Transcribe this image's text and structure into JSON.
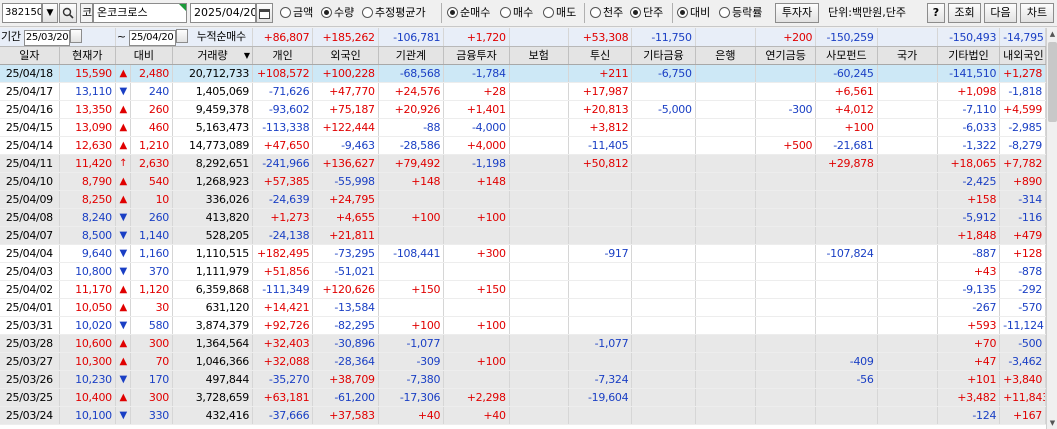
{
  "toolbar": {
    "code": "382150",
    "market_glyph": "코",
    "name": "온코크로스",
    "date": "2025/04/20",
    "radios1": [
      {
        "label": "금액",
        "on": false
      },
      {
        "label": "수량",
        "on": true
      },
      {
        "label": "추정평균가",
        "on": false
      }
    ],
    "radios2": [
      {
        "label": "순매수",
        "on": true
      },
      {
        "label": "매수",
        "on": false
      },
      {
        "label": "매도",
        "on": false
      }
    ],
    "radios3": [
      {
        "label": "천주",
        "on": false
      },
      {
        "label": "단주",
        "on": true
      }
    ],
    "radios4": [
      {
        "label": "대비",
        "on": true
      },
      {
        "label": "등락률",
        "on": false
      }
    ],
    "investor_button": "투자자",
    "unit_text": "단위:백만원,단주",
    "help": "?",
    "query": "조회",
    "next": "다음",
    "chart": "차트"
  },
  "summary": {
    "period_label": "기간",
    "from": "25/03/20",
    "tilde": "~",
    "to": "25/04/20",
    "cum_label": "누적순매수",
    "values": [
      "+86,807",
      "+185,262",
      "-106,781",
      "+1,720",
      "",
      "+53,308",
      "-11,750",
      "",
      "+200",
      "-150,259",
      "",
      "-150,493",
      "-14,795"
    ],
    "colors": [
      "r",
      "r",
      "b",
      "r",
      "k",
      "r",
      "b",
      "k",
      "r",
      "b",
      "k",
      "b",
      "b"
    ]
  },
  "headers": [
    "일자",
    "현재가",
    "대비",
    "거래량",
    "개인",
    "외국인",
    "기관계",
    "금융투자",
    "보험",
    "투신",
    "기타금융",
    "은행",
    "연기금등",
    "사모펀드",
    "국가",
    "기타법인",
    "내외국인"
  ],
  "rows": [
    {
      "cells": [
        "25/04/18",
        "15,590",
        "▲",
        "2,480",
        "20,712,733",
        "+108,572",
        "+100,228",
        "-68,568",
        "-1,784",
        "",
        "+211",
        "-6,750",
        "",
        "",
        "-60,245",
        "",
        "-141,510",
        "+1,278"
      ],
      "sel": true
    },
    {
      "cells": [
        "25/04/17",
        "13,110",
        "▼",
        "240",
        "1,405,069",
        "-71,626",
        "+47,770",
        "+24,576",
        "+28",
        "",
        "+17,987",
        "",
        "",
        "",
        "+6,561",
        "",
        "+1,098",
        "-1,818"
      ]
    },
    {
      "cells": [
        "25/04/16",
        "13,350",
        "▲",
        "260",
        "9,459,378",
        "-93,602",
        "+75,187",
        "+20,926",
        "+1,401",
        "",
        "+20,813",
        "-5,000",
        "",
        "-300",
        "+4,012",
        "",
        "-7,110",
        "+4,599"
      ]
    },
    {
      "cells": [
        "25/04/15",
        "13,090",
        "▲",
        "460",
        "5,163,473",
        "-113,338",
        "+122,444",
        "-88",
        "-4,000",
        "",
        "+3,812",
        "",
        "",
        "",
        "+100",
        "",
        "-6,033",
        "-2,985"
      ]
    },
    {
      "cells": [
        "25/04/14",
        "12,630",
        "▲",
        "1,210",
        "14,773,089",
        "+47,650",
        "-9,463",
        "-28,586",
        "+4,000",
        "",
        "-11,405",
        "",
        "",
        "+500",
        "-21,681",
        "",
        "-1,322",
        "-8,279"
      ]
    },
    {
      "cells": [
        "25/04/11",
        "11,420",
        "↑",
        "2,630",
        "8,292,651",
        "-241,966",
        "+136,627",
        "+79,492",
        "-1,198",
        "",
        "+50,812",
        "",
        "",
        "",
        "+29,878",
        "",
        "+18,065",
        "+7,782"
      ]
    },
    {
      "cells": [
        "25/04/10",
        "8,790",
        "▲",
        "540",
        "1,268,923",
        "+57,385",
        "-55,998",
        "+148",
        "+148",
        "",
        "",
        "",
        "",
        "",
        "",
        "",
        "-2,425",
        "+890"
      ]
    },
    {
      "cells": [
        "25/04/09",
        "8,250",
        "▲",
        "10",
        "336,026",
        "-24,639",
        "+24,795",
        "",
        "",
        "",
        "",
        "",
        "",
        "",
        "",
        "",
        "+158",
        "-314"
      ]
    },
    {
      "cells": [
        "25/04/08",
        "8,240",
        "▼",
        "260",
        "413,820",
        "+1,273",
        "+4,655",
        "+100",
        "+100",
        "",
        "",
        "",
        "",
        "",
        "",
        "",
        "-5,912",
        "-116"
      ]
    },
    {
      "cells": [
        "25/04/07",
        "8,500",
        "▼",
        "1,140",
        "528,205",
        "-24,138",
        "+21,811",
        "",
        "",
        "",
        "",
        "",
        "",
        "",
        "",
        "",
        "+1,848",
        "+479"
      ]
    },
    {
      "cells": [
        "25/04/04",
        "9,640",
        "▼",
        "1,160",
        "1,110,515",
        "+182,495",
        "-73,295",
        "-108,441",
        "+300",
        "",
        "-917",
        "",
        "",
        "",
        "-107,824",
        "",
        "-887",
        "+128"
      ]
    },
    {
      "cells": [
        "25/04/03",
        "10,800",
        "▼",
        "370",
        "1,111,979",
        "+51,856",
        "-51,021",
        "",
        "",
        "",
        "",
        "",
        "",
        "",
        "",
        "",
        "+43",
        "-878"
      ]
    },
    {
      "cells": [
        "25/04/02",
        "11,170",
        "▲",
        "1,120",
        "6,359,868",
        "-111,349",
        "+120,626",
        "+150",
        "+150",
        "",
        "",
        "",
        "",
        "",
        "",
        "",
        "-9,135",
        "-292"
      ]
    },
    {
      "cells": [
        "25/04/01",
        "10,050",
        "▲",
        "30",
        "631,120",
        "+14,421",
        "-13,584",
        "",
        "",
        "",
        "",
        "",
        "",
        "",
        "",
        "",
        "-267",
        "-570"
      ]
    },
    {
      "cells": [
        "25/03/31",
        "10,020",
        "▼",
        "580",
        "3,874,379",
        "+92,726",
        "-82,295",
        "+100",
        "+100",
        "",
        "",
        "",
        "",
        "",
        "",
        "",
        "+593",
        "-11,124"
      ]
    },
    {
      "cells": [
        "25/03/28",
        "10,600",
        "▲",
        "300",
        "1,364,564",
        "+32,403",
        "-30,896",
        "-1,077",
        "",
        "",
        "-1,077",
        "",
        "",
        "",
        "",
        "",
        "+70",
        "-500"
      ]
    },
    {
      "cells": [
        "25/03/27",
        "10,300",
        "▲",
        "70",
        "1,046,366",
        "+32,088",
        "-28,364",
        "-309",
        "+100",
        "",
        "",
        "",
        "",
        "",
        "-409",
        "",
        "+47",
        "-3,462"
      ]
    },
    {
      "cells": [
        "25/03/26",
        "10,230",
        "▼",
        "170",
        "497,844",
        "-35,270",
        "+38,709",
        "-7,380",
        "",
        "",
        "-7,324",
        "",
        "",
        "",
        "-56",
        "",
        "+101",
        "+3,840"
      ]
    },
    {
      "cells": [
        "25/03/25",
        "10,400",
        "▲",
        "300",
        "3,728,659",
        "+63,181",
        "-61,200",
        "-17,306",
        "+2,298",
        "",
        "-19,604",
        "",
        "",
        "",
        "",
        "",
        "+3,482",
        "+11,843"
      ]
    },
    {
      "cells": [
        "25/03/24",
        "10,100",
        "▼",
        "330",
        "432,416",
        "-37,666",
        "+37,583",
        "+40",
        "+40",
        "",
        "",
        "",
        "",
        "",
        "",
        "",
        "-124",
        "+167"
      ]
    }
  ],
  "colors": {
    "up": "#e00000",
    "down": "#1a3fc4",
    "selected_row": "#cde8f6",
    "alt_row": "#e8e8e8"
  }
}
